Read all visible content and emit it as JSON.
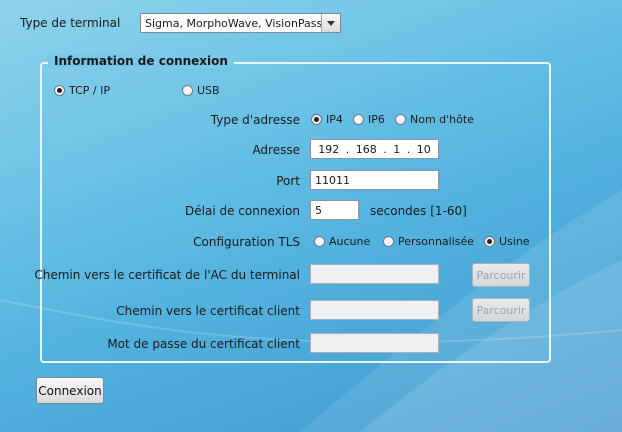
{
  "terminal": {
    "label": "Type de terminal",
    "selected": "Sigma, MorphoWave, VisionPass"
  },
  "group": {
    "title": "Information de connexion",
    "connection_types": [
      {
        "label": "TCP / IP",
        "checked": true
      },
      {
        "label": "USB",
        "checked": false
      }
    ],
    "address_type": {
      "label": "Type d'adresse",
      "options": [
        {
          "label": "IP4",
          "checked": true
        },
        {
          "label": "IP6",
          "checked": false
        },
        {
          "label": "Nom d'hôte",
          "checked": false
        }
      ]
    },
    "address": {
      "label": "Adresse",
      "octets": [
        "192",
        "168",
        "1",
        "10"
      ]
    },
    "port": {
      "label": "Port",
      "value": "11011"
    },
    "timeout": {
      "label": "Délai de connexion",
      "value": "5",
      "suffix": "secondes [1-60]"
    },
    "tls": {
      "label": "Configuration TLS",
      "options": [
        {
          "label": "Aucune",
          "checked": false
        },
        {
          "label": "Personnalisée",
          "checked": false
        },
        {
          "label": "Usine",
          "checked": true
        }
      ]
    },
    "ca_cert": {
      "label": "Chemin vers le certificat de l'AC du terminal",
      "value": "",
      "browse": "Parcourir"
    },
    "client_cert": {
      "label": "Chemin vers le certificat client",
      "value": "",
      "browse": "Parcourir"
    },
    "client_pass": {
      "label": "Mot de passe du certificat client",
      "value": ""
    }
  },
  "connect_label": "Connexion"
}
